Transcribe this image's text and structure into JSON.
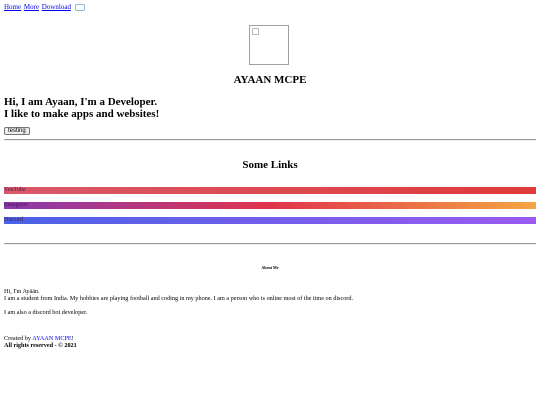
{
  "nav": {
    "home": "Home",
    "more": "More",
    "download": "Download",
    "extra_icon": "external-link-icon"
  },
  "profile": {
    "avatar_icon": "broken-image-icon",
    "name": "AYAAN MCPE",
    "intro_line1": "Hi, I am Ayaan, I'm a Developer.",
    "intro_line2": "I like to make apps and websites!",
    "button_label": "testing"
  },
  "links": {
    "title": "Some Links",
    "items": [
      {
        "label": "YouTube"
      },
      {
        "label": "Instagram"
      },
      {
        "label": "Discord"
      }
    ]
  },
  "about": {
    "title": "About Me",
    "greeting": "Hi, I'm Ayään.",
    "bio": "I am a student from India. My hobbies are playing football and coding in my phone. I am a person who is online most of the time on discord.",
    "extra": "I am also a discord bot developer."
  },
  "footer": {
    "created_by": "Created by ",
    "author": "AYAAN MCPE",
    "exclaim": "!",
    "rights": "All rights reserved - © 2021"
  }
}
